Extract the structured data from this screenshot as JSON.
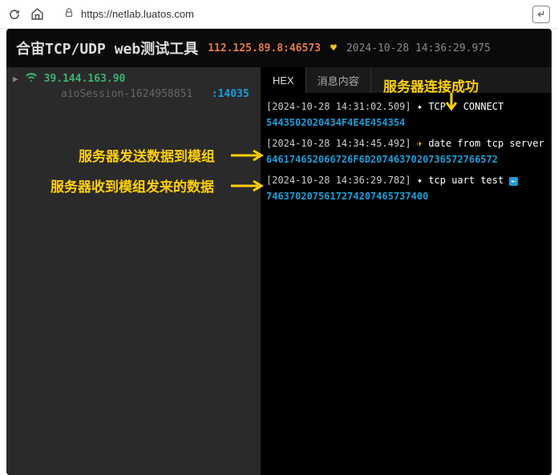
{
  "browser": {
    "url": "https://netlab.luatos.com"
  },
  "header": {
    "title": "合宙TCP/UDP web测试工具",
    "server": "112.125.89.8:46573",
    "timestamp": "2024-10-28 14:36:29.975"
  },
  "left": {
    "ip": "39.144.163.90",
    "session_label": "aioSession-1624958851",
    "session_port": ":14035"
  },
  "tabs": {
    "hex": "HEX",
    "content": "消息内容"
  },
  "log": {
    "l1_ts": "[2024-10-28 14:31:02.509]",
    "l1_tag": "TCP",
    "l1_msg": "CONNECT",
    "l2_hex": "5443502020434F4E4E454354",
    "l3_ts": "[2024-10-28 14:34:45.492]",
    "l3_msg": "date from tcp server",
    "l4_hex": "646174652066726F6D2074637020736572766572",
    "l5_ts": "[2024-10-28 14:36:29.782]",
    "l5_msg": "tcp uart test",
    "l5_icon": "←",
    "l6_hex": "7463702075617274207465737400"
  },
  "annotations": {
    "a1": "服务器连接成功",
    "a2": "服务器发送数据到模组",
    "a3": "服务器收到模组发来的数据"
  }
}
